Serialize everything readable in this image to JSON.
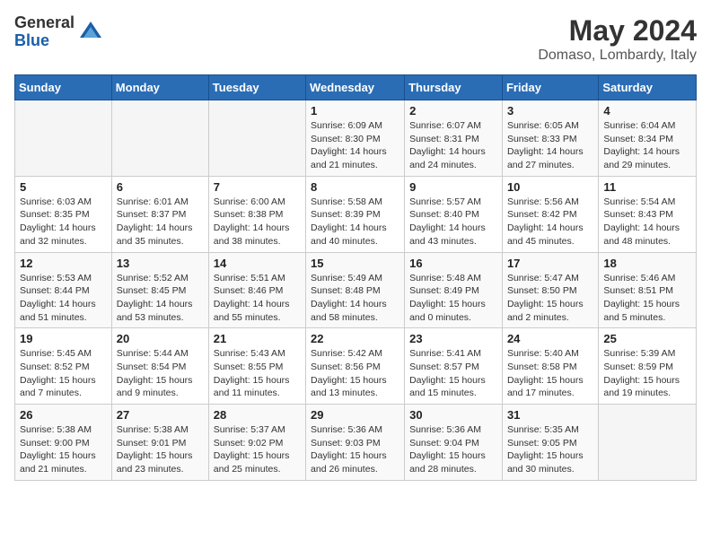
{
  "logo": {
    "general": "General",
    "blue": "Blue"
  },
  "title": "May 2024",
  "location": "Domaso, Lombardy, Italy",
  "weekdays": [
    "Sunday",
    "Monday",
    "Tuesday",
    "Wednesday",
    "Thursday",
    "Friday",
    "Saturday"
  ],
  "weeks": [
    [
      {
        "day": "",
        "info": ""
      },
      {
        "day": "",
        "info": ""
      },
      {
        "day": "",
        "info": ""
      },
      {
        "day": "1",
        "info": "Sunrise: 6:09 AM\nSunset: 8:30 PM\nDaylight: 14 hours\nand 21 minutes."
      },
      {
        "day": "2",
        "info": "Sunrise: 6:07 AM\nSunset: 8:31 PM\nDaylight: 14 hours\nand 24 minutes."
      },
      {
        "day": "3",
        "info": "Sunrise: 6:05 AM\nSunset: 8:33 PM\nDaylight: 14 hours\nand 27 minutes."
      },
      {
        "day": "4",
        "info": "Sunrise: 6:04 AM\nSunset: 8:34 PM\nDaylight: 14 hours\nand 29 minutes."
      }
    ],
    [
      {
        "day": "5",
        "info": "Sunrise: 6:03 AM\nSunset: 8:35 PM\nDaylight: 14 hours\nand 32 minutes."
      },
      {
        "day": "6",
        "info": "Sunrise: 6:01 AM\nSunset: 8:37 PM\nDaylight: 14 hours\nand 35 minutes."
      },
      {
        "day": "7",
        "info": "Sunrise: 6:00 AM\nSunset: 8:38 PM\nDaylight: 14 hours\nand 38 minutes."
      },
      {
        "day": "8",
        "info": "Sunrise: 5:58 AM\nSunset: 8:39 PM\nDaylight: 14 hours\nand 40 minutes."
      },
      {
        "day": "9",
        "info": "Sunrise: 5:57 AM\nSunset: 8:40 PM\nDaylight: 14 hours\nand 43 minutes."
      },
      {
        "day": "10",
        "info": "Sunrise: 5:56 AM\nSunset: 8:42 PM\nDaylight: 14 hours\nand 45 minutes."
      },
      {
        "day": "11",
        "info": "Sunrise: 5:54 AM\nSunset: 8:43 PM\nDaylight: 14 hours\nand 48 minutes."
      }
    ],
    [
      {
        "day": "12",
        "info": "Sunrise: 5:53 AM\nSunset: 8:44 PM\nDaylight: 14 hours\nand 51 minutes."
      },
      {
        "day": "13",
        "info": "Sunrise: 5:52 AM\nSunset: 8:45 PM\nDaylight: 14 hours\nand 53 minutes."
      },
      {
        "day": "14",
        "info": "Sunrise: 5:51 AM\nSunset: 8:46 PM\nDaylight: 14 hours\nand 55 minutes."
      },
      {
        "day": "15",
        "info": "Sunrise: 5:49 AM\nSunset: 8:48 PM\nDaylight: 14 hours\nand 58 minutes."
      },
      {
        "day": "16",
        "info": "Sunrise: 5:48 AM\nSunset: 8:49 PM\nDaylight: 15 hours\nand 0 minutes."
      },
      {
        "day": "17",
        "info": "Sunrise: 5:47 AM\nSunset: 8:50 PM\nDaylight: 15 hours\nand 2 minutes."
      },
      {
        "day": "18",
        "info": "Sunrise: 5:46 AM\nSunset: 8:51 PM\nDaylight: 15 hours\nand 5 minutes."
      }
    ],
    [
      {
        "day": "19",
        "info": "Sunrise: 5:45 AM\nSunset: 8:52 PM\nDaylight: 15 hours\nand 7 minutes."
      },
      {
        "day": "20",
        "info": "Sunrise: 5:44 AM\nSunset: 8:54 PM\nDaylight: 15 hours\nand 9 minutes."
      },
      {
        "day": "21",
        "info": "Sunrise: 5:43 AM\nSunset: 8:55 PM\nDaylight: 15 hours\nand 11 minutes."
      },
      {
        "day": "22",
        "info": "Sunrise: 5:42 AM\nSunset: 8:56 PM\nDaylight: 15 hours\nand 13 minutes."
      },
      {
        "day": "23",
        "info": "Sunrise: 5:41 AM\nSunset: 8:57 PM\nDaylight: 15 hours\nand 15 minutes."
      },
      {
        "day": "24",
        "info": "Sunrise: 5:40 AM\nSunset: 8:58 PM\nDaylight: 15 hours\nand 17 minutes."
      },
      {
        "day": "25",
        "info": "Sunrise: 5:39 AM\nSunset: 8:59 PM\nDaylight: 15 hours\nand 19 minutes."
      }
    ],
    [
      {
        "day": "26",
        "info": "Sunrise: 5:38 AM\nSunset: 9:00 PM\nDaylight: 15 hours\nand 21 minutes."
      },
      {
        "day": "27",
        "info": "Sunrise: 5:38 AM\nSunset: 9:01 PM\nDaylight: 15 hours\nand 23 minutes."
      },
      {
        "day": "28",
        "info": "Sunrise: 5:37 AM\nSunset: 9:02 PM\nDaylight: 15 hours\nand 25 minutes."
      },
      {
        "day": "29",
        "info": "Sunrise: 5:36 AM\nSunset: 9:03 PM\nDaylight: 15 hours\nand 26 minutes."
      },
      {
        "day": "30",
        "info": "Sunrise: 5:36 AM\nSunset: 9:04 PM\nDaylight: 15 hours\nand 28 minutes."
      },
      {
        "day": "31",
        "info": "Sunrise: 5:35 AM\nSunset: 9:05 PM\nDaylight: 15 hours\nand 30 minutes."
      },
      {
        "day": "",
        "info": ""
      }
    ]
  ]
}
